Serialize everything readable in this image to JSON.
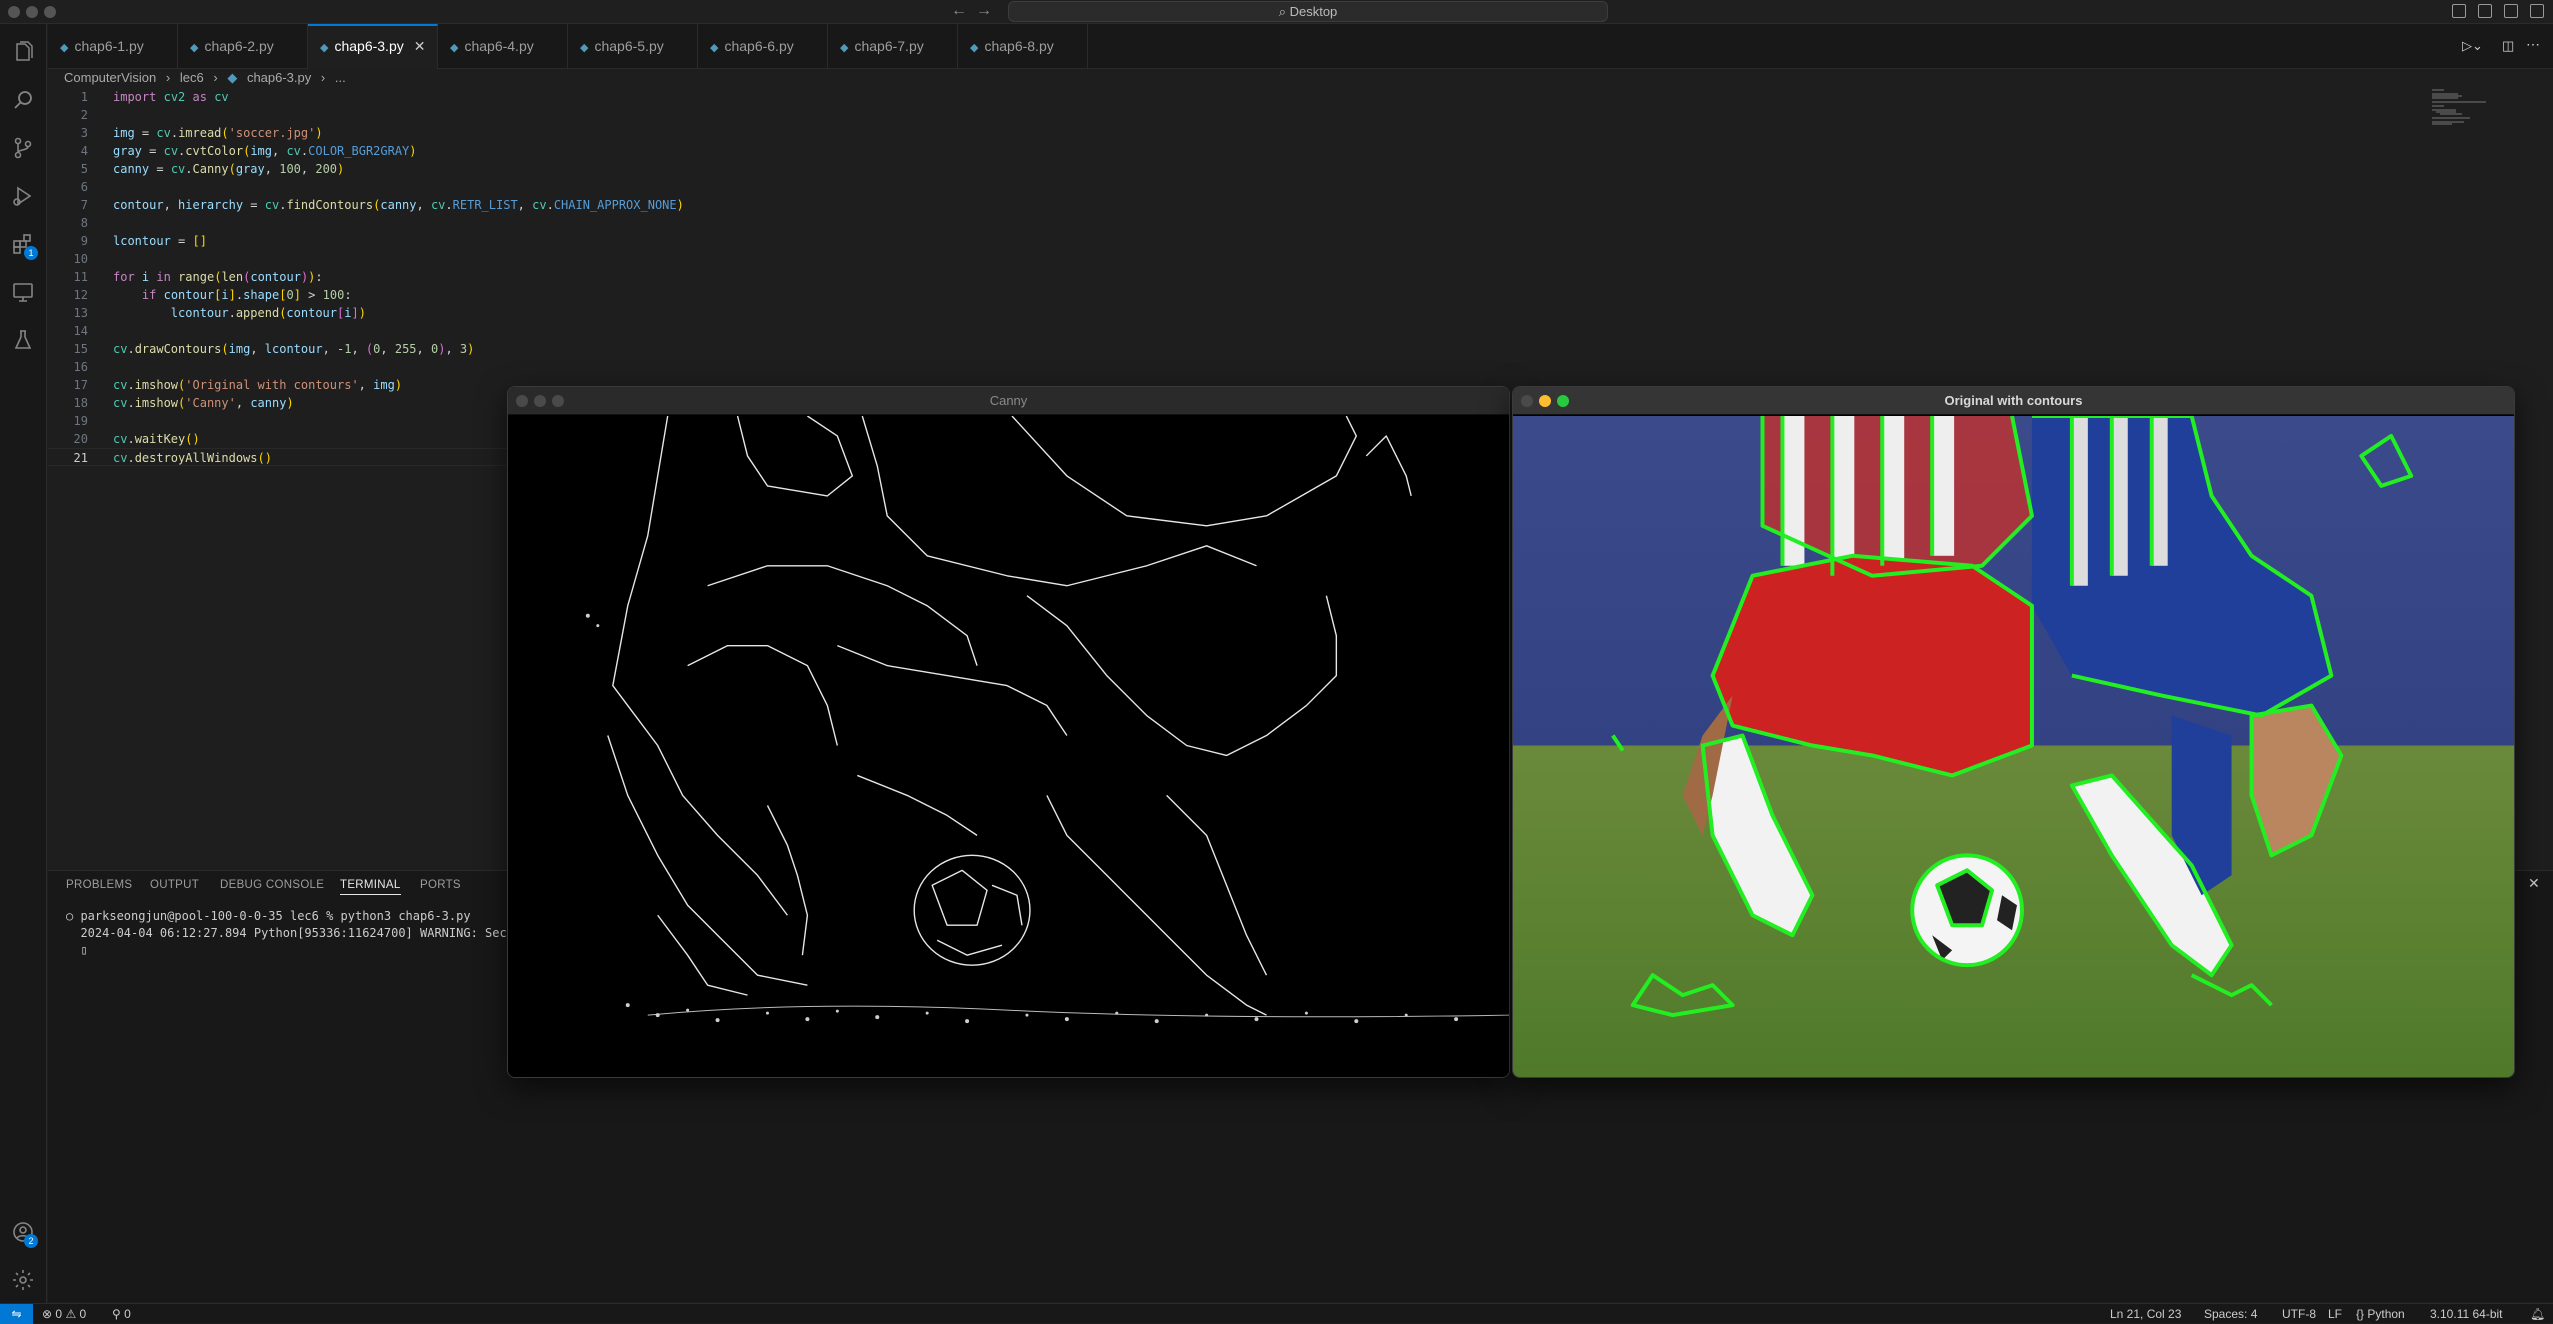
{
  "titlebar": {
    "search_text": "⌕ Desktop"
  },
  "tabs": [
    {
      "label": "chap6-1.py",
      "active": false
    },
    {
      "label": "chap6-2.py",
      "active": false
    },
    {
      "label": "chap6-3.py",
      "active": true
    },
    {
      "label": "chap6-4.py",
      "active": false
    },
    {
      "label": "chap6-5.py",
      "active": false
    },
    {
      "label": "chap6-6.py",
      "active": false
    },
    {
      "label": "chap6-7.py",
      "active": false
    },
    {
      "label": "chap6-8.py",
      "active": false
    }
  ],
  "breadcrumb": {
    "folder1": "ComputerVision",
    "sep": "›",
    "folder2": "lec6",
    "file": "chap6-3.py",
    "more": "..."
  },
  "editor": {
    "line_numbers": [
      "1",
      "2",
      "3",
      "4",
      "5",
      "6",
      "7",
      "8",
      "9",
      "10",
      "11",
      "12",
      "13",
      "14",
      "15",
      "16",
      "17",
      "18",
      "19",
      "20",
      "21"
    ],
    "current_line": "21"
  },
  "panel": {
    "tabs": [
      "PROBLEMS",
      "OUTPUT",
      "DEBUG CONSOLE",
      "TERMINAL",
      "PORTS"
    ],
    "active_tab": "TERMINAL",
    "terminal_lines": [
      "○ parkseongjun@pool-100-0-0-35 lec6 % python3 chap6-3.py",
      "  2024-04-04 06:12:27.894 Python[95336:11624700] WARNING: Secure",
      "  ▯"
    ]
  },
  "windows": {
    "canny_title": "Canny",
    "original_title": "Original with contours"
  },
  "statusbar": {
    "errors": "0",
    "warnings": "0",
    "ports": "0",
    "position": "Ln 21, Col 23",
    "spaces": "Spaces: 4",
    "encoding": "UTF-8",
    "eol": "LF",
    "language": "Python",
    "interpreter": "3.10.11 64-bit"
  },
  "badges": {
    "extensions": "1",
    "accounts": "2"
  }
}
